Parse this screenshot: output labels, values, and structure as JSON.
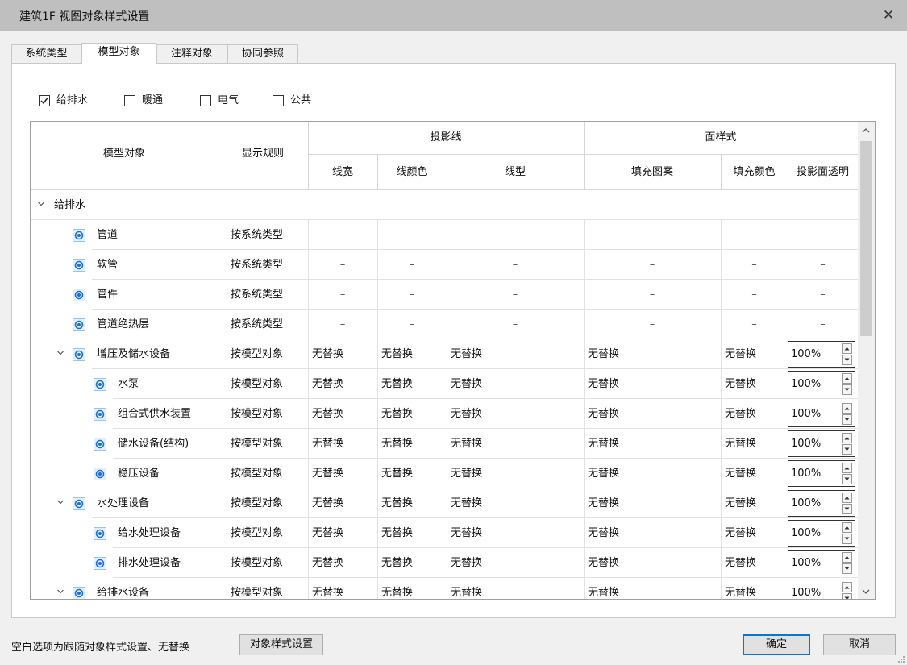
{
  "window": {
    "title": "建筑1F 视图对象样式设置",
    "close": "✕"
  },
  "tabs": [
    "系统类型",
    "模型对象",
    "注释对象",
    "协同参照"
  ],
  "filters": [
    {
      "label": "给排水",
      "checked": true
    },
    {
      "label": "暖通",
      "checked": false
    },
    {
      "label": "电气",
      "checked": false
    },
    {
      "label": "公共",
      "checked": false
    }
  ],
  "header": {
    "model_object": "模型对象",
    "display_rule": "显示规则",
    "projection_line": "投影线",
    "line_width": "线宽",
    "line_color": "线颜色",
    "line_type": "线型",
    "surface_style": "面样式",
    "fill_pattern": "填充图案",
    "fill_color": "填充颜色",
    "transparency": "投影面透明"
  },
  "group": {
    "label": "给排水",
    "chevron_icon": "chevron-down-icon"
  },
  "rows": [
    {
      "name": "管道",
      "rule": "按系统类型",
      "cells": [
        "–",
        "–",
        "–",
        "–",
        "–",
        "–"
      ],
      "level": 1,
      "expandable": false
    },
    {
      "name": "软管",
      "rule": "按系统类型",
      "cells": [
        "–",
        "–",
        "–",
        "–",
        "–",
        "–"
      ],
      "level": 1,
      "expandable": false
    },
    {
      "name": "管件",
      "rule": "按系统类型",
      "cells": [
        "–",
        "–",
        "–",
        "–",
        "–",
        "–"
      ],
      "level": 1,
      "expandable": false
    },
    {
      "name": "管道绝热层",
      "rule": "按系统类型",
      "cells": [
        "–",
        "–",
        "–",
        "–",
        "–",
        "–"
      ],
      "level": 1,
      "expandable": false
    },
    {
      "name": "增压及储水设备",
      "rule": "按模型对象",
      "cells": [
        "无替换",
        "无替换",
        "无替换",
        "无替换",
        "无替换",
        "100%"
      ],
      "level": 1,
      "expandable": true
    },
    {
      "name": "水泵",
      "rule": "按模型对象",
      "cells": [
        "无替换",
        "无替换",
        "无替换",
        "无替换",
        "无替换",
        "100%"
      ],
      "level": 2,
      "expandable": false
    },
    {
      "name": "组合式供水装置",
      "rule": "按模型对象",
      "cells": [
        "无替换",
        "无替换",
        "无替换",
        "无替换",
        "无替换",
        "100%"
      ],
      "level": 2,
      "expandable": false
    },
    {
      "name": "储水设备(结构)",
      "rule": "按模型对象",
      "cells": [
        "无替换",
        "无替换",
        "无替换",
        "无替换",
        "无替换",
        "100%"
      ],
      "level": 2,
      "expandable": false
    },
    {
      "name": "稳压设备",
      "rule": "按模型对象",
      "cells": [
        "无替换",
        "无替换",
        "无替换",
        "无替换",
        "无替换",
        "100%"
      ],
      "level": 2,
      "expandable": false
    },
    {
      "name": "水处理设备",
      "rule": "按模型对象",
      "cells": [
        "无替换",
        "无替换",
        "无替换",
        "无替换",
        "无替换",
        "100%"
      ],
      "level": 1,
      "expandable": true
    },
    {
      "name": "给水处理设备",
      "rule": "按模型对象",
      "cells": [
        "无替换",
        "无替换",
        "无替换",
        "无替换",
        "无替换",
        "100%"
      ],
      "level": 2,
      "expandable": false
    },
    {
      "name": "排水处理设备",
      "rule": "按模型对象",
      "cells": [
        "无替换",
        "无替换",
        "无替换",
        "无替换",
        "无替换",
        "100%"
      ],
      "level": 2,
      "expandable": false
    },
    {
      "name": "给排水设备",
      "rule": "按模型对象",
      "cells": [
        "无替换",
        "无替换",
        "无替换",
        "无替换",
        "无替换",
        "100%"
      ],
      "level": 1,
      "expandable": true
    }
  ],
  "footer": {
    "hint": "空白选项为跟随对象样式设置、无替换",
    "object_style_button": "对象样式设置",
    "ok": "确定",
    "cancel": "取消"
  },
  "colors": {
    "accent": "#0078d7",
    "eye_icon": "#1a6fd6",
    "titlebar": "#bfbfbf"
  },
  "icons": {
    "visibility": "eye-icon",
    "expand": "chevron-down-icon"
  }
}
